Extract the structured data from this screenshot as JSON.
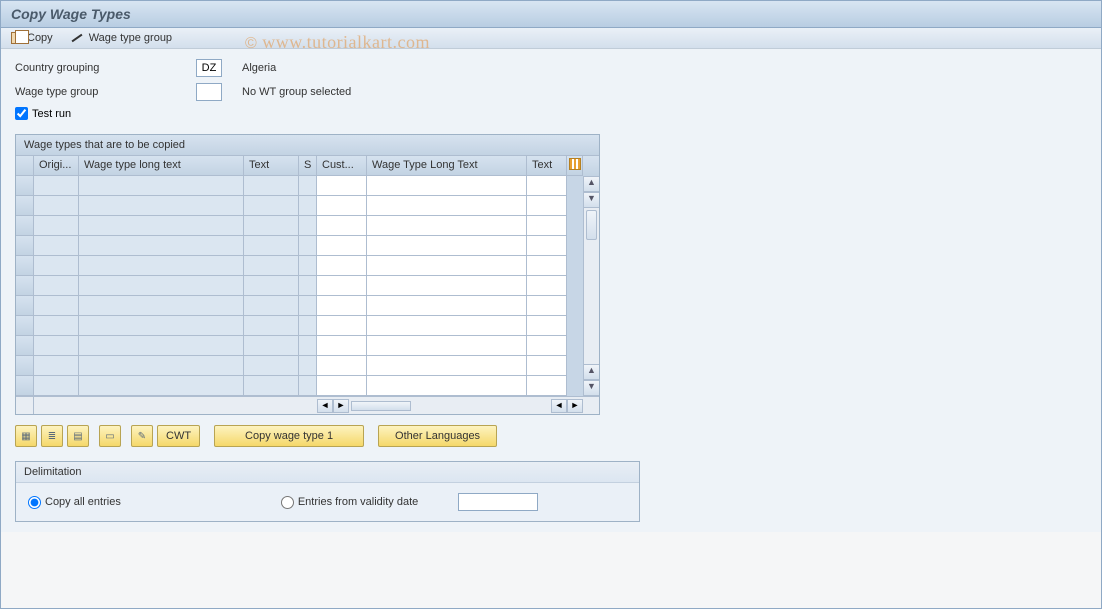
{
  "title": "Copy Wage Types",
  "toolbar": {
    "copy": "Copy",
    "wage_type_group": "Wage type group"
  },
  "watermark": "© www.tutorialkart.com",
  "form": {
    "country_label": "Country grouping",
    "country_code": "DZ",
    "country_name": "Algeria",
    "wtg_label": "Wage type group",
    "wtg_code": "",
    "wtg_text": "No WT group selected",
    "test_run_label": "Test run",
    "test_run_checked": true
  },
  "grid": {
    "title": "Wage types that are to be copied",
    "columns": {
      "origi": "Origi...",
      "wt1": "Wage type long text",
      "text1": "Text",
      "s": "S",
      "cust": "Cust...",
      "wt2": "Wage Type Long Text",
      "text2": "Text"
    },
    "row_count": 11
  },
  "buttons": {
    "cwt": "CWT",
    "copy_wt1": "Copy wage type 1",
    "other_lang": "Other Languages"
  },
  "delimitation": {
    "title": "Delimitation",
    "copy_all": "Copy all entries",
    "from_validity": "Entries from validity date",
    "date_value": ""
  }
}
